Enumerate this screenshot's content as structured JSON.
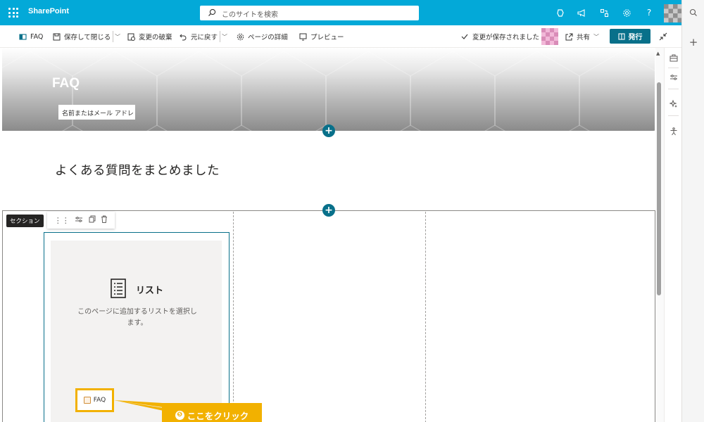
{
  "suite_bar": {
    "app_name": "SharePoint",
    "search_placeholder": "このサイトを検索",
    "icons": [
      "waffle-icon",
      "copilot-icon",
      "megaphone-icon",
      "share-network-icon",
      "settings-icon",
      "help-icon"
    ],
    "help_glyph": "?"
  },
  "command_bar": {
    "page_name": "FAQ",
    "save_close": "保存して閉じる",
    "discard": "変更の破棄",
    "undo": "元に戻す",
    "page_details": "ページの詳細",
    "preview": "プレビュー",
    "saved_status": "変更が保存されました",
    "share": "共有",
    "publish": "発行"
  },
  "hero": {
    "title": "FAQ",
    "author_placeholder": "名前またはメール アドレ"
  },
  "text_webpart": {
    "body": "よくある質問をまとめました"
  },
  "section": {
    "label": "セクション"
  },
  "list_webpart": {
    "title": "リスト",
    "description": "このページに追加するリストを選択します。",
    "list_item": "FAQ"
  },
  "annotation": {
    "step_number": "❺",
    "text": "ここをクリック",
    "color": "#f2b100"
  },
  "colors": {
    "suite_bar": "#03a9d8",
    "accent": "#08708a"
  }
}
